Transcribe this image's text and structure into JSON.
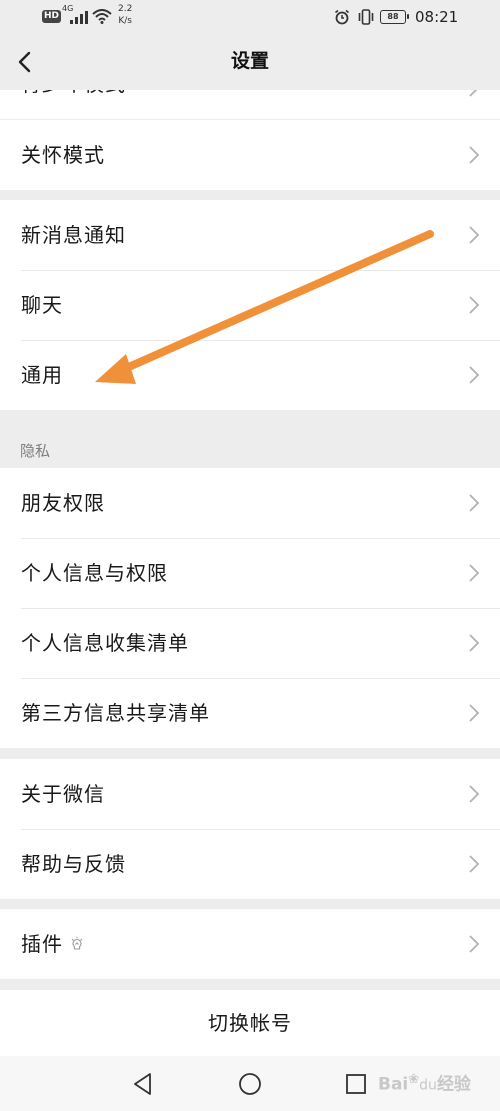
{
  "status_bar": {
    "hd": "HD",
    "network": "4G",
    "speed_value": "2.2",
    "speed_unit": "K/s",
    "battery": "88",
    "time": "08:21"
  },
  "header": {
    "title": "设置"
  },
  "partial_row": {
    "label": "青少年模式"
  },
  "groups": {
    "g1": [
      {
        "label": "关怀模式"
      }
    ],
    "g2": [
      {
        "label": "新消息通知"
      },
      {
        "label": "聊天"
      },
      {
        "label": "通用"
      }
    ],
    "privacy_header": "隐私",
    "g3": [
      {
        "label": "朋友权限"
      },
      {
        "label": "个人信息与权限"
      },
      {
        "label": "个人信息收集清单"
      },
      {
        "label": "第三方信息共享清单"
      }
    ],
    "g4": [
      {
        "label": "关于微信"
      },
      {
        "label": "帮助与反馈"
      }
    ],
    "g5": [
      {
        "label": "插件"
      }
    ]
  },
  "switch_account": "切换帐号",
  "watermark": {
    "brand": "Bai",
    "brand_end": "经验",
    "sub": "du"
  },
  "colors": {
    "background": "#ededed",
    "cell": "#ffffff",
    "annotation": "#f0913a"
  },
  "icons": {
    "back": "chevron-left-icon",
    "row": "chevron-right-icon",
    "plugin": "plugin-bulb-icon"
  }
}
